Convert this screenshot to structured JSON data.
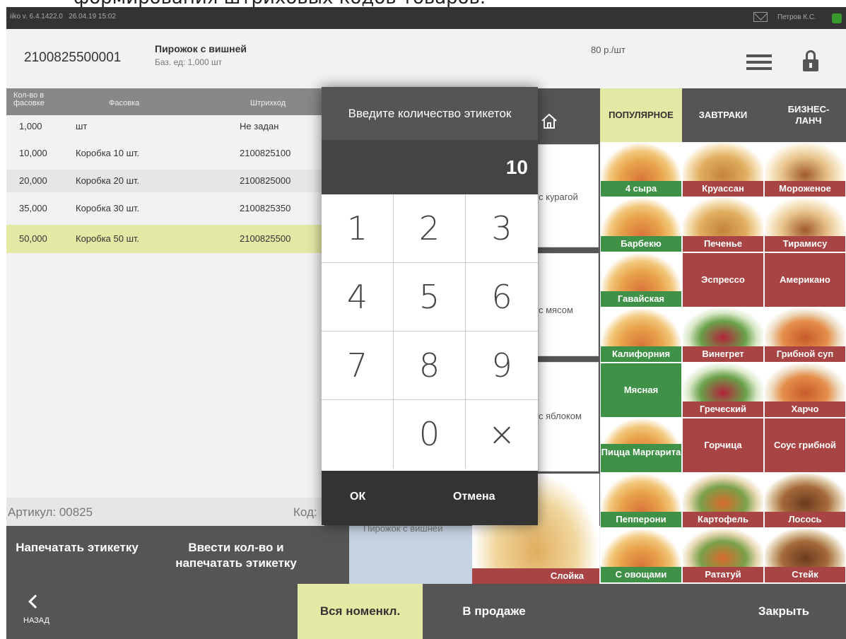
{
  "caption": "формирования штриховых кодов товаров.",
  "topbar": {
    "version": "iiko v. 6.4.1422.0",
    "datetime": "26.04.19 15:02",
    "user": "Петров К.С."
  },
  "header": {
    "barcode": "2100825500001",
    "product_name": "Пирожок с вишней",
    "base_unit": "Баз. ед: 1,000 шт",
    "price": "80 р./шт"
  },
  "table": {
    "columns": [
      "Кол-во в фасовке",
      "Фасовка",
      "Штрихкод"
    ],
    "rows": [
      {
        "qty": "1,000",
        "pack": "шт",
        "barcode": "Не задан"
      },
      {
        "qty": "10,000",
        "pack": "Коробка 10 шт.",
        "barcode": "2100825100"
      },
      {
        "qty": "20,000",
        "pack": "Коробка 20 шт.",
        "barcode": "2100825000"
      },
      {
        "qty": "35,000",
        "pack": "Коробка 30 шт.",
        "barcode": "2100825350"
      },
      {
        "qty": "50,000",
        "pack": "Коробка 50 шт.",
        "barcode": "2100825500"
      }
    ]
  },
  "footer_info": {
    "article": "Артикул: 00825",
    "code": "Код:"
  },
  "actions": {
    "print": "Напечатать этикетку",
    "qty_print": "Ввести кол-во и напечатать этикетку",
    "product_tile": "Пирожок с вишней"
  },
  "bottom": {
    "back": "НАЗАД",
    "all": "Вся номенкл.",
    "sale": "В продаже",
    "close": "Закрыть"
  },
  "mid_cards": [
    "с курагой",
    "с мясом",
    "с яблоком"
  ],
  "categories": [
    "ПОПУЛЯРНОЕ",
    "ЗАВТРАКИ",
    "БИЗНЕС-ЛАНЧ"
  ],
  "tiles": [
    "4 сыра",
    "Круассан",
    "Мороженое",
    "Барбекю",
    "Печенье",
    "Тирамису",
    "Гавайская",
    "Эспрессо",
    "Американо",
    "Калифорния",
    "Винегрет",
    "Грибной суп",
    "Мясная",
    "Греческий",
    "Харчо",
    "Пицца Маргарита",
    "Горчица",
    "Соус грибной",
    "Пепперони",
    "Картофель",
    "Лосось",
    "С овощами",
    "Рататуй",
    "Стейк"
  ],
  "slice": "Слойка",
  "dialog": {
    "title": "Введите количество этикеток",
    "value": "10",
    "keys": [
      "1",
      "2",
      "3",
      "4",
      "5",
      "6",
      "7",
      "8",
      "9",
      "",
      "0",
      "×"
    ],
    "ok": "ОК",
    "cancel": "Отмена"
  },
  "colors": {
    "green": "#3e9146",
    "red": "#a94444",
    "highlight": "#e3e8a4",
    "dark": "#555555"
  }
}
